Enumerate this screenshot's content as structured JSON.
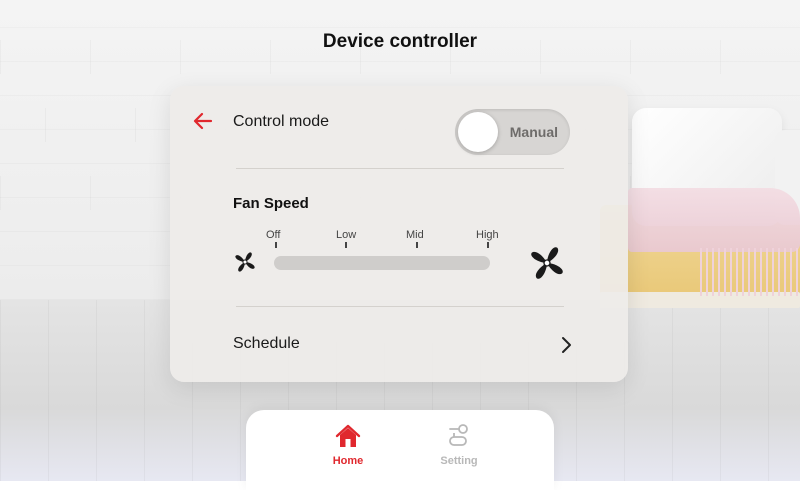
{
  "header": {
    "title": "Device controller"
  },
  "control": {
    "mode_label": "Control mode",
    "toggle_text": "Manual",
    "back_icon": "arrow-left-icon",
    "accent": "#e0282e"
  },
  "fan": {
    "title": "Fan Speed",
    "levels": [
      "Off",
      "Low",
      "Mid",
      "High"
    ],
    "min_icon": "fan-small-icon",
    "max_icon": "fan-large-icon"
  },
  "schedule": {
    "label": "Schedule",
    "icon": "chevron-right-icon"
  },
  "nav": {
    "items": [
      {
        "label": "Home",
        "icon": "home-icon",
        "active": true,
        "color": "#e0282e"
      },
      {
        "label": "Setting",
        "icon": "settings-sliders-icon",
        "active": false,
        "color": "#b8b8b8"
      }
    ]
  }
}
